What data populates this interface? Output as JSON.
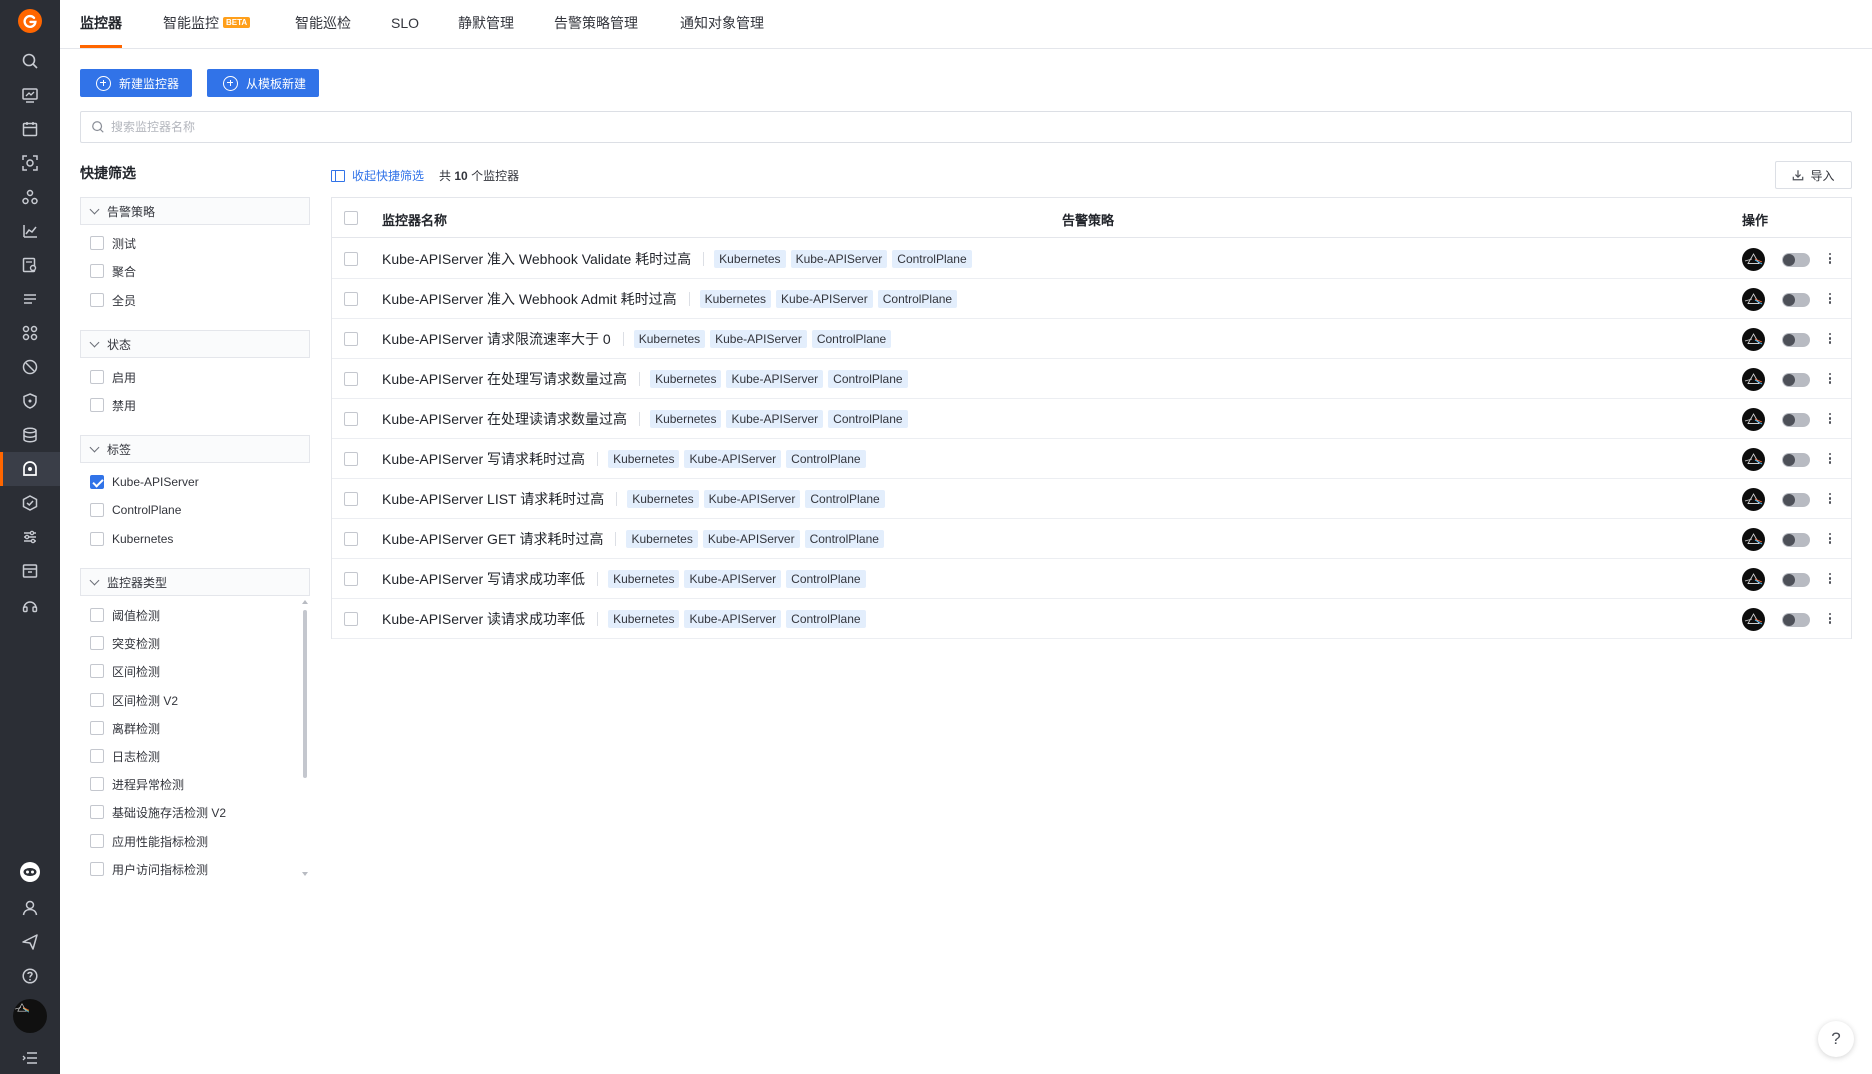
{
  "tabs": [
    {
      "label": "监控器",
      "active": true
    },
    {
      "label": "智能监控",
      "badge": "BETA"
    },
    {
      "label": "智能巡检"
    },
    {
      "label": "SLO"
    },
    {
      "label": "静默管理"
    },
    {
      "label": "告警策略管理"
    },
    {
      "label": "通知对象管理"
    }
  ],
  "actions": {
    "new_monitor": "新建监控器",
    "new_from_template": "从模板新建"
  },
  "search": {
    "placeholder": "搜索监控器名称",
    "value": ""
  },
  "quick_filter": {
    "title": "快捷筛选",
    "groups": [
      {
        "title": "告警策略",
        "options": [
          {
            "label": "测试",
            "checked": false
          },
          {
            "label": "聚合",
            "checked": false
          },
          {
            "label": "全员",
            "checked": false
          }
        ]
      },
      {
        "title": "状态",
        "options": [
          {
            "label": "启用",
            "checked": false
          },
          {
            "label": "禁用",
            "checked": false
          }
        ]
      },
      {
        "title": "标签",
        "options": [
          {
            "label": "Kube-APIServer",
            "checked": true
          },
          {
            "label": "ControlPlane",
            "checked": false
          },
          {
            "label": "Kubernetes",
            "checked": false
          }
        ]
      },
      {
        "title": "监控器类型",
        "options": [
          {
            "label": "阈值检测",
            "checked": false
          },
          {
            "label": "突变检测",
            "checked": false
          },
          {
            "label": "区间检测",
            "checked": false
          },
          {
            "label": "区间检测 V2",
            "checked": false
          },
          {
            "label": "离群检测",
            "checked": false
          },
          {
            "label": "日志检测",
            "checked": false
          },
          {
            "label": "进程异常检测",
            "checked": false
          },
          {
            "label": "基础设施存活检测 V2",
            "checked": false
          },
          {
            "label": "应用性能指标检测",
            "checked": false
          },
          {
            "label": "用户访问指标检测",
            "checked": false
          }
        ]
      }
    ]
  },
  "toolbar": {
    "collapse_label": "收起快捷筛选",
    "count_prefix": "共",
    "count": "10",
    "count_suffix": "个监控器",
    "import_label": "导入"
  },
  "table": {
    "columns": {
      "name": "监控器名称",
      "policy": "告警策略",
      "ops": "操作"
    },
    "rows": [
      {
        "name": "Kube-APIServer 准入 Webhook Validate 耗时过高",
        "tags": [
          "Kubernetes",
          "Kube-APIServer",
          "ControlPlane"
        ],
        "enabled": false
      },
      {
        "name": "Kube-APIServer 准入 Webhook Admit 耗时过高",
        "tags": [
          "Kubernetes",
          "Kube-APIServer",
          "ControlPlane"
        ],
        "enabled": false
      },
      {
        "name": "Kube-APIServer 请求限流速率大于 0",
        "tags": [
          "Kubernetes",
          "Kube-APIServer",
          "ControlPlane"
        ],
        "enabled": false
      },
      {
        "name": "Kube-APIServer 在处理写请求数量过高",
        "tags": [
          "Kubernetes",
          "Kube-APIServer",
          "ControlPlane"
        ],
        "enabled": false
      },
      {
        "name": "Kube-APIServer 在处理读请求数量过高",
        "tags": [
          "Kubernetes",
          "Kube-APIServer",
          "ControlPlane"
        ],
        "enabled": false
      },
      {
        "name": "Kube-APIServer 写请求耗时过高",
        "tags": [
          "Kubernetes",
          "Kube-APIServer",
          "ControlPlane"
        ],
        "enabled": false
      },
      {
        "name": "Kube-APIServer LIST 请求耗时过高",
        "tags": [
          "Kubernetes",
          "Kube-APIServer",
          "ControlPlane"
        ],
        "enabled": false
      },
      {
        "name": "Kube-APIServer GET 请求耗时过高",
        "tags": [
          "Kubernetes",
          "Kube-APIServer",
          "ControlPlane"
        ],
        "enabled": false
      },
      {
        "name": "Kube-APIServer 写请求成功率低",
        "tags": [
          "Kubernetes",
          "Kube-APIServer",
          "ControlPlane"
        ],
        "enabled": false
      },
      {
        "name": "Kube-APIServer 读请求成功率低",
        "tags": [
          "Kubernetes",
          "Kube-APIServer",
          "ControlPlane"
        ],
        "enabled": false
      }
    ]
  },
  "help": {
    "label": "?"
  },
  "colors": {
    "accent": "#ff6600",
    "primary": "#3173e8",
    "rail": "#2b2e35",
    "tag_bg": "#e3eefc"
  }
}
